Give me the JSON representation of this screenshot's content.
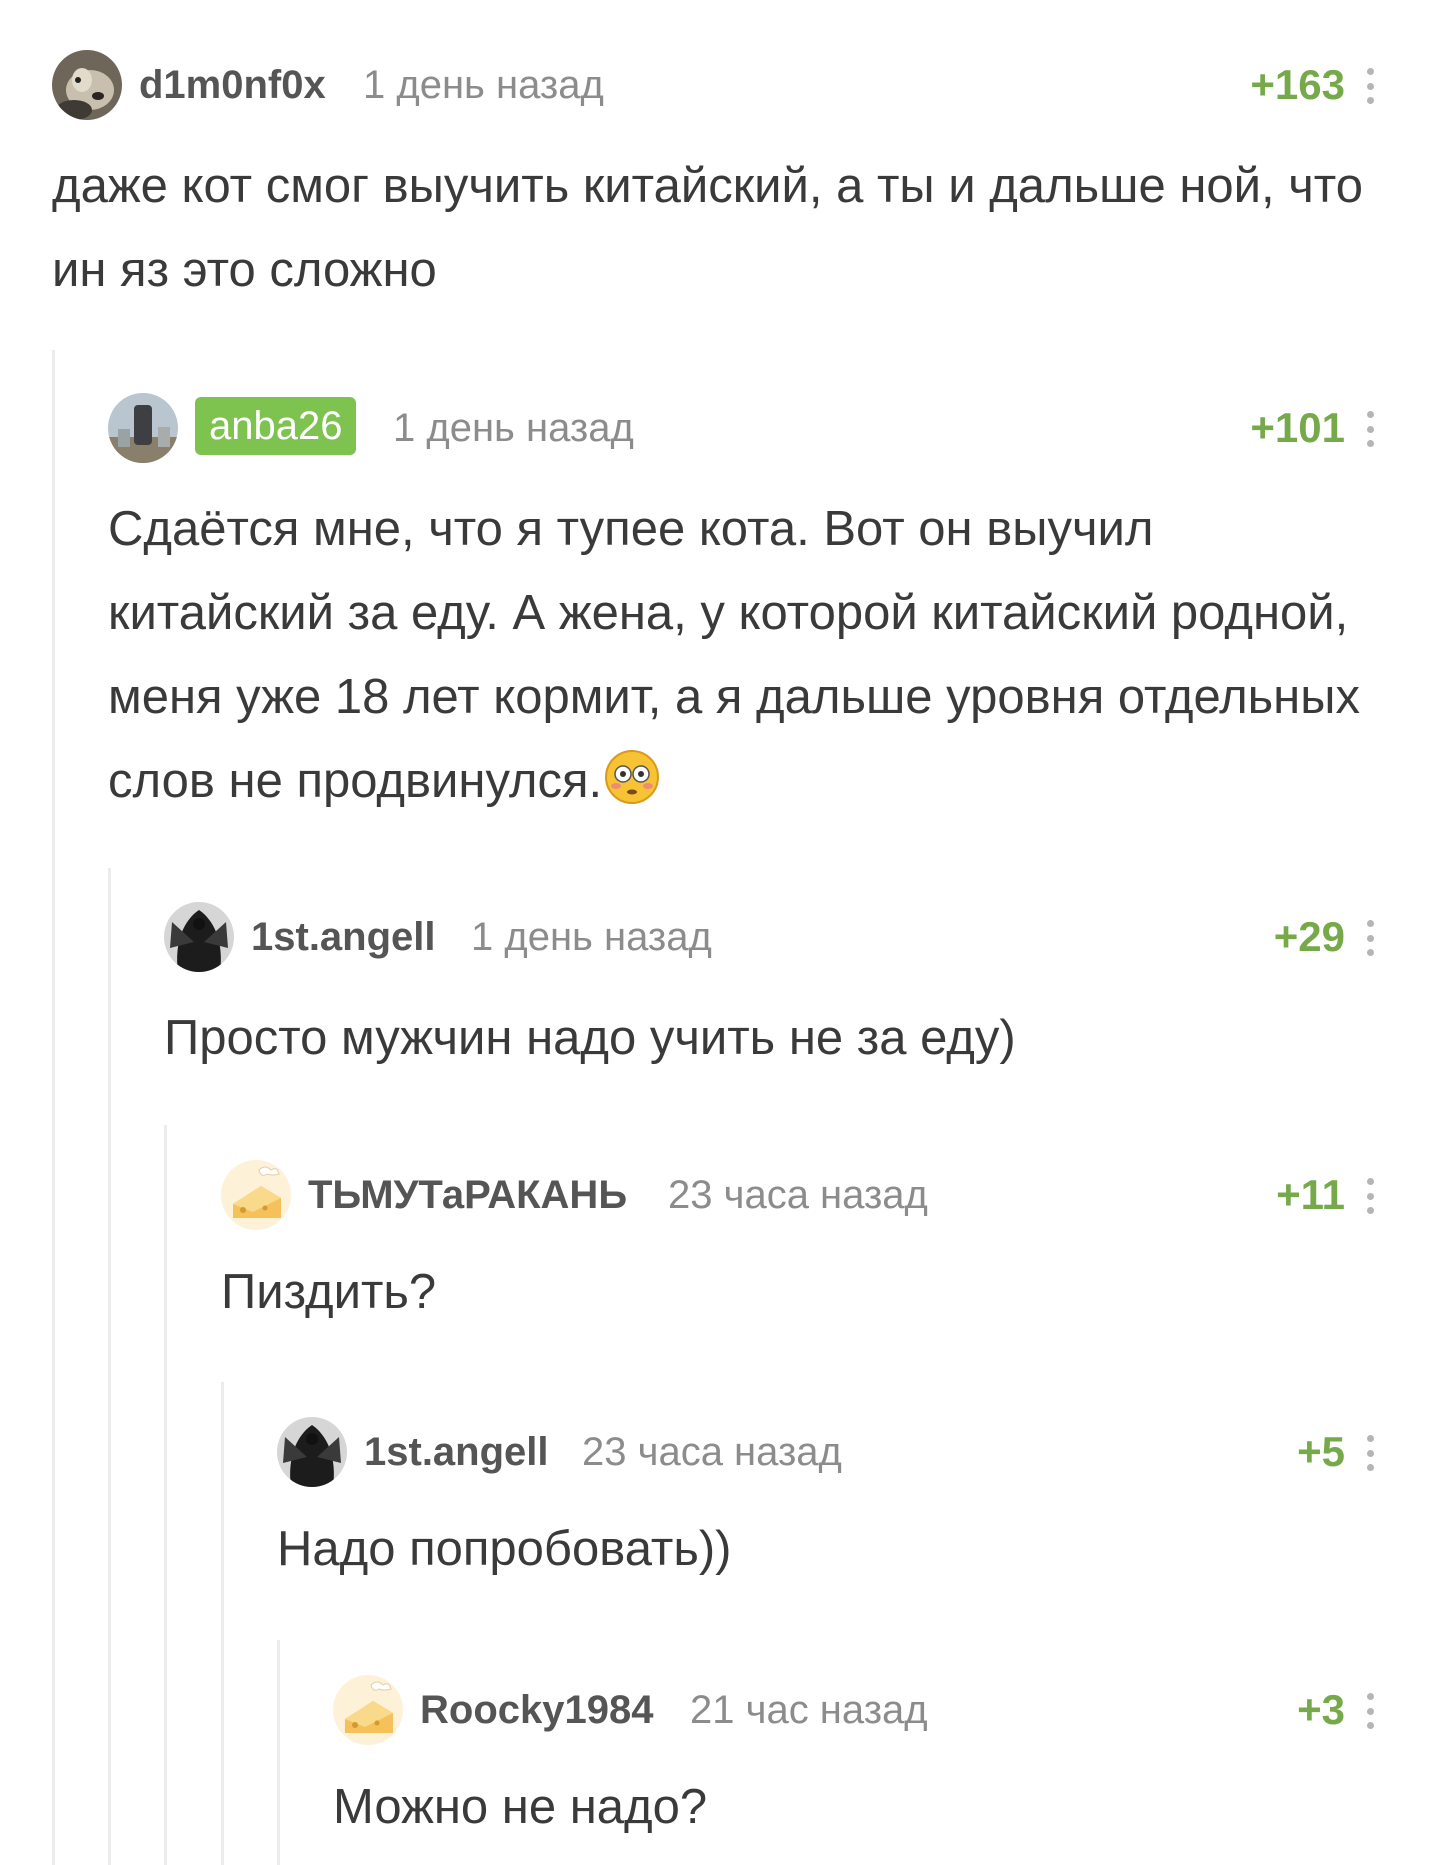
{
  "comments": [
    {
      "avatar": "dog-avatar",
      "username": "d1m0nf0x",
      "time": "1 день назад",
      "rating": "+163",
      "text": "даже кот смог выучить китайский, а ты и дальше ной, что ин яз это сложно"
    },
    {
      "avatar": "landscape-avatar",
      "username": "anba26",
      "highlighted_author": true,
      "time": "1 день назад",
      "rating": "+101",
      "text": "Сдаётся мне, что я тупее кота. Вот он выучил китайский за еду. А жена, у которой китайский родной, меня уже 18 лет кормит, а я дальше уровня отдельных слов не продвинулся.",
      "trailing_emoji": "flushed-face-emoji"
    },
    {
      "avatar": "dark-figure-avatar",
      "username": "1st.angell",
      "time": "1 день назад",
      "rating": "+29",
      "text": "Просто мужчин надо учить не за еду)"
    },
    {
      "avatar": "default-cheese-avatar",
      "username": "ТЬМУТаРАКАНЬ",
      "time": "23 часа назад",
      "rating": "+11",
      "text": "Пиздить?"
    },
    {
      "avatar": "dark-figure-avatar",
      "username": "1st.angell",
      "time": "23 часа назад",
      "rating": "+5",
      "text": "Надо попробовать))"
    },
    {
      "avatar": "default-cheese-avatar",
      "username": "Roocky1984",
      "time": "21 час назад",
      "rating": "+3",
      "text": "Можно не надо?"
    }
  ],
  "colors": {
    "rating": "#76a94a",
    "author_badge": "#7ec350",
    "meta": "#8c8c8c",
    "thread_line": "#ececec"
  }
}
